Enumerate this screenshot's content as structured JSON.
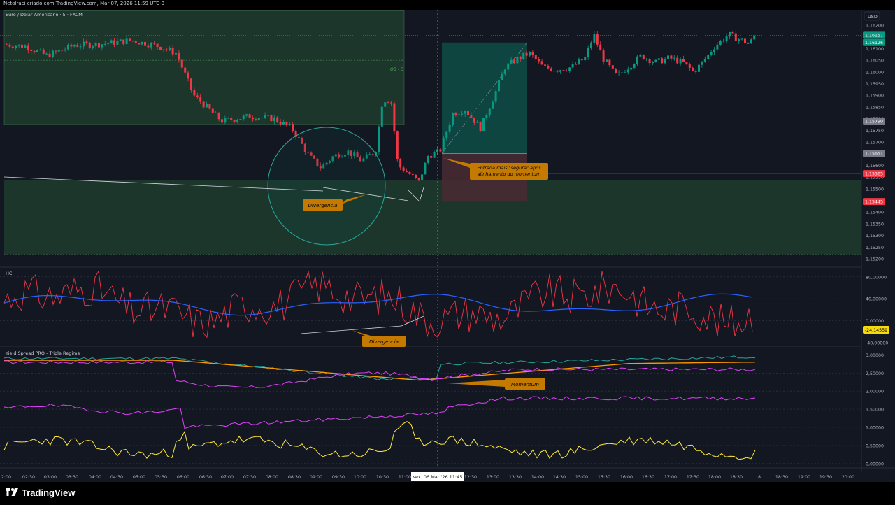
{
  "header": {
    "caption": "Netolraci criado com TradingView.com, Mar 07, 2026 11:59 UTC-3"
  },
  "brand": {
    "name": "TradingView"
  },
  "chart_data": [
    {
      "type": "candlestick",
      "title": "Euro / Dólar Americano · 5 · FXCM",
      "currency": "USD",
      "ylim": [
        1.1517,
        1.1626
      ],
      "y_ticks": [
        "1,16200",
        "1,16150",
        "1,16100",
        "1,16050",
        "1,16000",
        "1,15950",
        "1,15900",
        "1,15850",
        "1,15800",
        "1,15750",
        "1,15700",
        "1,15650",
        "1,15600",
        "1,15550",
        "1,15500",
        "1,15450",
        "1,15400",
        "1,15350",
        "1,15300",
        "1,15250",
        "1,15200"
      ],
      "price_labels": [
        {
          "text": "1,16157",
          "value": 1.16157,
          "color": "#089981"
        },
        {
          "text": "1,16126",
          "value": 1.16126,
          "color": "#089981"
        },
        {
          "text": "1,15790",
          "value": 1.1579,
          "color": "#787b86"
        },
        {
          "text": "1,15651",
          "value": 1.15651,
          "color": "#787b86"
        },
        {
          "text": "1,15565",
          "value": 1.15565,
          "color": "#f23645"
        },
        {
          "text": "1,15445",
          "value": 1.15445,
          "color": "#f23645"
        }
      ],
      "zones": [
        {
          "label": "OB - D",
          "color": "#1e3a2c"
        },
        {
          "label": "",
          "color": "#1e3a2c"
        }
      ],
      "long_position": {
        "entry": 1.15651,
        "target": 1.16126,
        "stop": 1.15445
      },
      "annotations": [
        {
          "text": "Divergencia"
        },
        {
          "text": "Entrada mais \"segura\" apos alinhamento do momentum"
        }
      ],
      "candles_shape": "synthetic reconstruction of price path: 1.1612 → 1.1578 → 1.1555 → 1.1590 → 1.1550 → 1.1620 → 1.1600 → 1.1615"
    },
    {
      "type": "line",
      "title": "HCI",
      "ylim": [
        -45,
        95
      ],
      "y_ticks": [
        "80,00000",
        "40,00000",
        "0,00000",
        "-40,00000"
      ],
      "highlight_label": {
        "text": "-24,14559",
        "value": -24.14559,
        "color": "#f5d90a"
      },
      "annotations": [
        {
          "text": "Divergencia"
        }
      ],
      "series": [
        {
          "name": "",
          "color": "#f23645"
        },
        {
          "name": "",
          "color": "#2962ff"
        }
      ]
    },
    {
      "type": "line",
      "title": "Yield Spread PRO - Triple Regime",
      "ylim": [
        -0.1,
        3.2
      ],
      "y_ticks": [
        "3,00000",
        "2,50000",
        "2,00000",
        "1,50000",
        "1,00000",
        "0,50000",
        "0,00000"
      ],
      "annotations": [
        {
          "text": "Momentum"
        }
      ],
      "series": [
        {
          "name": "",
          "color": "#26a69a"
        },
        {
          "name": "",
          "color": "#ff9800"
        },
        {
          "name": "",
          "color": "#e040fb"
        },
        {
          "name": "",
          "color": "#ffeb3b"
        }
      ]
    }
  ],
  "time_axis": {
    "ticks": [
      "2:00",
      "02:30",
      "03:00",
      "03:30",
      "04:00",
      "04:30",
      "05:00",
      "05:30",
      "06:00",
      "06:30",
      "07:00",
      "07:30",
      "08:00",
      "08:30",
      "09:00",
      "09:30",
      "10:00",
      "10:30",
      "11:00",
      "12:30",
      "13:00",
      "13:30",
      "14:00",
      "14:30",
      "15:00",
      "15:30",
      "16:00",
      "16:30",
      "17:00",
      "17:30",
      "18:00",
      "18:30",
      "8",
      "18:30",
      "19:00",
      "19:30",
      "20:00"
    ],
    "cursor_label": "sex. 06 Mar '26   11:45"
  },
  "colors": {
    "background": "#131722",
    "bull": "#089981",
    "bear": "#f23645",
    "grid": "#363a45"
  }
}
